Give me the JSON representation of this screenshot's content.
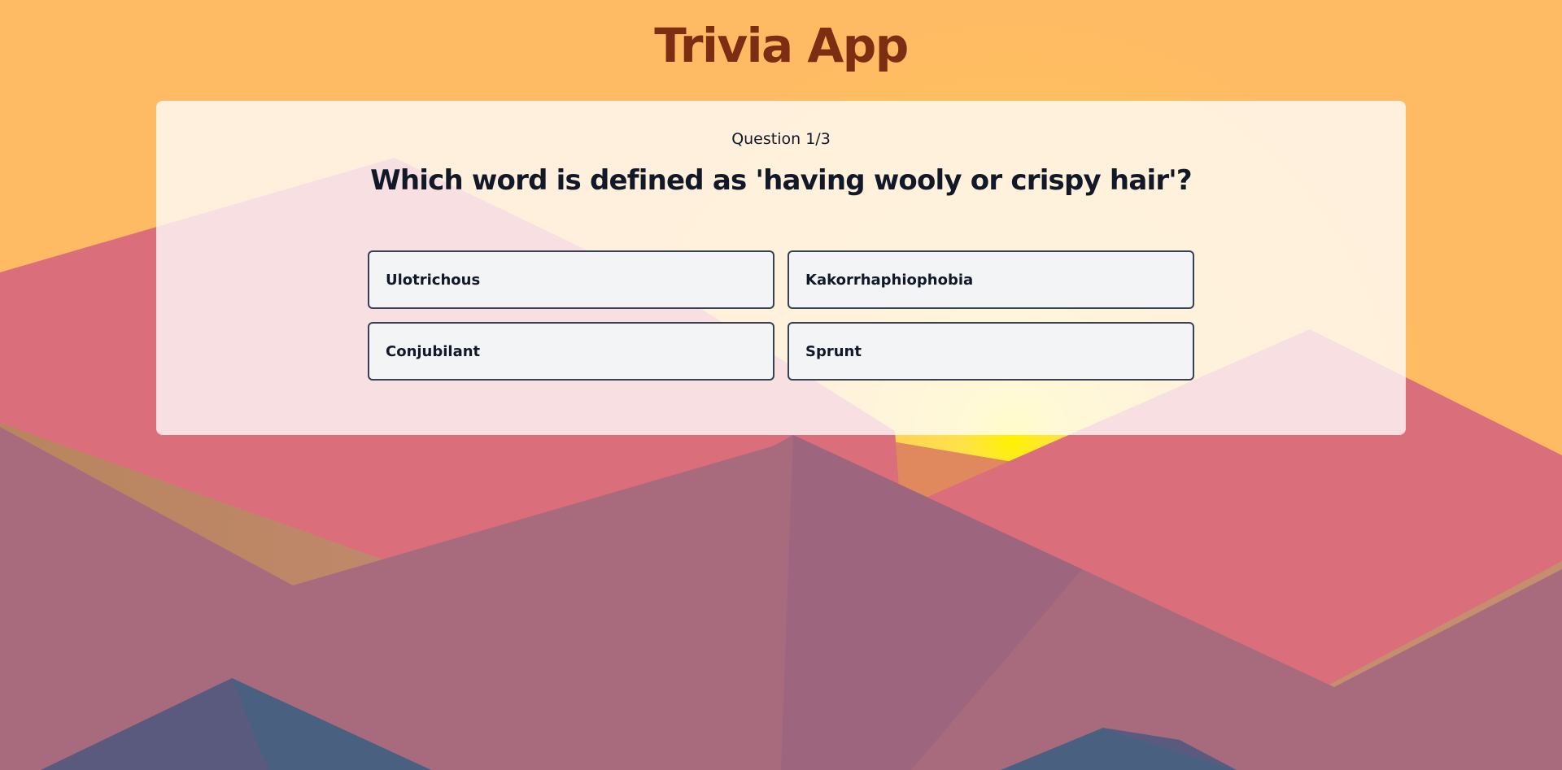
{
  "app": {
    "title": "Trivia App"
  },
  "quiz": {
    "progress": "Question 1/3",
    "question": "Which word is defined as 'having wooly or crispy hair'?",
    "answers": [
      {
        "label": "Ulotrichous"
      },
      {
        "label": "Kakorrhaphiophobia"
      },
      {
        "label": "Conjubilant"
      },
      {
        "label": "Sprunt"
      }
    ]
  },
  "theme": {
    "background": "#ffbb63",
    "title_color": "#7c2d12",
    "card_bg": "#ffffff",
    "answer_bg": "#f3f4f6",
    "answer_border": "#374151"
  }
}
